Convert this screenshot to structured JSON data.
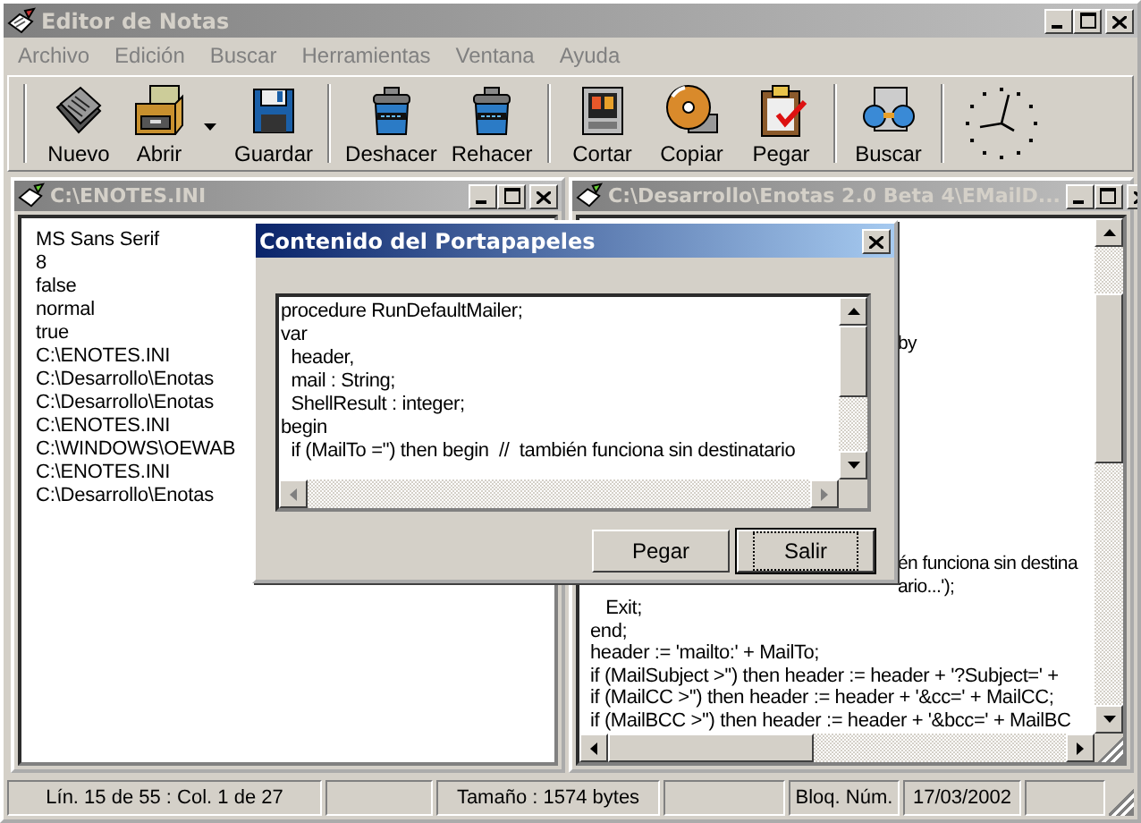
{
  "window": {
    "title": "Editor de Notas",
    "active": false
  },
  "menu": [
    {
      "label": "Archivo",
      "disabled": true
    },
    {
      "label": "Edición",
      "disabled": true
    },
    {
      "label": "Buscar",
      "disabled": true
    },
    {
      "label": "Herramientas",
      "disabled": true
    },
    {
      "label": "Ventana",
      "disabled": true
    },
    {
      "label": "Ayuda",
      "disabled": true
    }
  ],
  "toolbar": {
    "groups": [
      [
        {
          "label": "Nuevo",
          "kind": "new",
          "dropdown": false
        },
        {
          "label": "Abrir",
          "kind": "open",
          "dropdown": true
        },
        {
          "label": "Guardar",
          "kind": "save",
          "dropdown": false
        }
      ],
      [
        {
          "label": "Deshacer",
          "kind": "undo",
          "dropdown": false
        },
        {
          "label": "Rehacer",
          "kind": "redo",
          "dropdown": false
        }
      ],
      [
        {
          "label": "Cortar",
          "kind": "cut",
          "dropdown": false
        },
        {
          "label": "Copiar",
          "kind": "copy",
          "dropdown": false
        },
        {
          "label": "Pegar",
          "kind": "paste",
          "dropdown": false
        }
      ],
      [
        {
          "label": "Buscar",
          "kind": "find",
          "dropdown": false
        }
      ]
    ]
  },
  "left_document": {
    "title": "C:\\ENOTES.INI",
    "active": false,
    "lines": [
      "MS Sans Serif",
      "8",
      "false",
      "normal",
      "true",
      "C:\\ENOTES.INI",
      "C:\\Desarrollo\\Enotas",
      "C:\\Desarrollo\\Enotas",
      "C:\\ENOTES.INI",
      "C:\\WINDOWS\\OEWAB",
      "C:\\ENOTES.INI",
      "C:\\Desarrollo\\Enotas"
    ]
  },
  "right_document": {
    "title": "C:\\Desarrollo\\Enotas 2.0 Beta 4\\EMailD...",
    "active": false,
    "top_fragment": "by",
    "lower_fragments": [
      "én funciona sin destina",
      "ario...');"
    ],
    "lines": [
      "   Exit;",
      "end;",
      "header := 'mailto:' + MailTo;",
      "if (MailSubject >'') then header := header + '?Subject=' +",
      "if (MailCC >'') then header := header + '&cc=' + MailCC;",
      "if (MailBCC >'') then header := header + '&bcc=' + MailBC"
    ]
  },
  "dialog": {
    "title": "Contenido del Portapapeles",
    "active": true,
    "memo_lines": [
      "procedure RunDefaultMailer;",
      "var",
      "  header,",
      "  mail : String;",
      "  ShellResult : integer;",
      "begin",
      "  if (MailTo ='') then begin  //  también funciona sin destinatario"
    ],
    "buttons": [
      {
        "label": "Pegar",
        "default": false
      },
      {
        "label": "Salir",
        "default": true
      }
    ]
  },
  "status_bar": {
    "position": "Lín.  15 de 55 : Col.  1 de 27",
    "size": "Tamaño : 1574 bytes",
    "num_lock": "Bloq. Núm.",
    "date": "17/03/2002"
  }
}
